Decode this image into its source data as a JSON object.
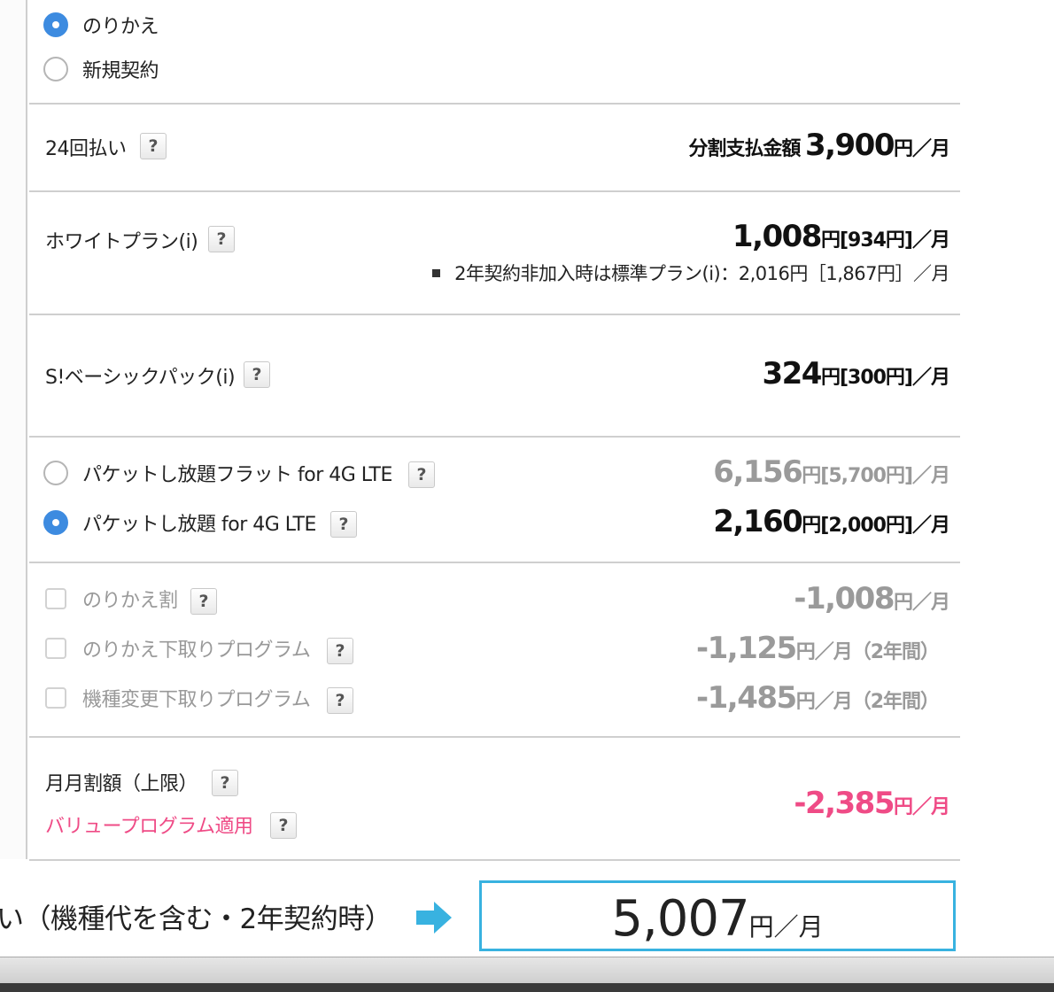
{
  "contract_type": {
    "options": [
      {
        "label": "のりかえ",
        "selected": true
      },
      {
        "label": "新規契約",
        "selected": false
      }
    ]
  },
  "installment": {
    "label": "24回払い",
    "help": "?",
    "amount_label": "分割支払金額",
    "amount": "3,900",
    "unit": "円／月"
  },
  "basic_plan": {
    "label": "ホワイトプラン(i)",
    "help": "?",
    "price": "1,008",
    "price_unit": "円[934円]／月",
    "note": "2年契約非加入時は標準プラン(i)：2,016円［1,867円］／月"
  },
  "basic_pack": {
    "label": "S!ベーシックパック(i)",
    "help": "?",
    "price": "324",
    "price_unit": "円[300円]／月"
  },
  "packet_plans": [
    {
      "label": "パケットし放題フラット for 4G LTE",
      "help": "?",
      "price": "6,156",
      "price_unit": "円[5,700円]／月",
      "selected": false
    },
    {
      "label": "パケットし放題 for 4G LTE",
      "help": "?",
      "price": "2,160",
      "price_unit": "円[2,000円]／月",
      "selected": true
    }
  ],
  "discounts": [
    {
      "label": "のりかえ割",
      "help": "?",
      "price": "-1,008",
      "price_unit": "円／月"
    },
    {
      "label": "のりかえ下取りプログラム",
      "help": "?",
      "price": "-1,125",
      "price_unit": "円／月（2年間）"
    },
    {
      "label": "機種変更下取りプログラム",
      "help": "?",
      "price": "-1,485",
      "price_unit": "円／月（2年間）"
    }
  ],
  "monthly_discount": {
    "label": "月月割額（上限）",
    "help": "?",
    "sub_label": "バリュープログラム適用",
    "sub_help": "?",
    "price": "-2,385",
    "price_unit": "円／月"
  },
  "total": {
    "label": "い（機種代を含む・2年契約時）",
    "value": "5,007",
    "unit": "円／月"
  },
  "colors": {
    "accent_blue": "#3d8be0",
    "total_border": "#38b2e0",
    "discount_pink": "#ef4b86",
    "divider": "#cfcfcf"
  }
}
